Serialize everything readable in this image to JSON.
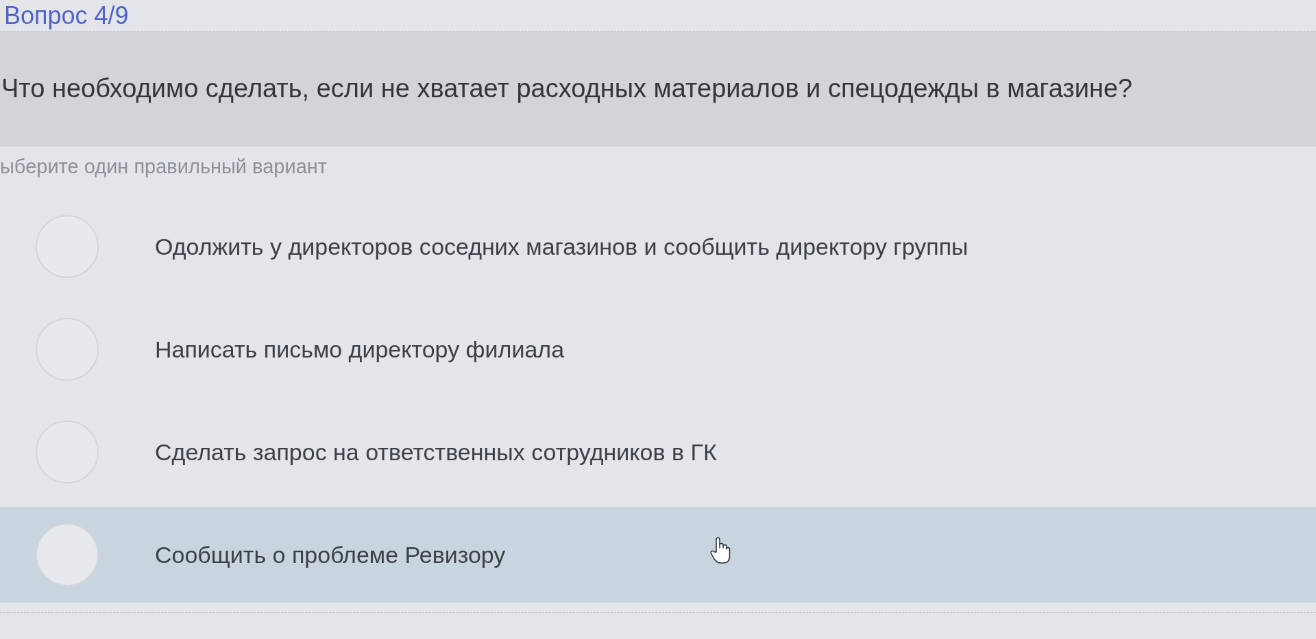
{
  "header": {
    "counter": "Вопрос 4/9",
    "question": "Что необходимо сделать, если не хватает расходных материалов и спецодежды в магазине?"
  },
  "instruction": "ыберите один правильный вариант",
  "options": [
    {
      "label": "Одолжить у директоров соседних магазинов и сообщить директору группы",
      "selected": false,
      "hovered": false
    },
    {
      "label": "Написать письмо директору филиала",
      "selected": false,
      "hovered": false
    },
    {
      "label": "Сделать запрос на ответственных сотрудников в ГК",
      "selected": false,
      "hovered": false
    },
    {
      "label": "Сообщить о проблеме Ревизору",
      "selected": false,
      "hovered": true
    }
  ]
}
